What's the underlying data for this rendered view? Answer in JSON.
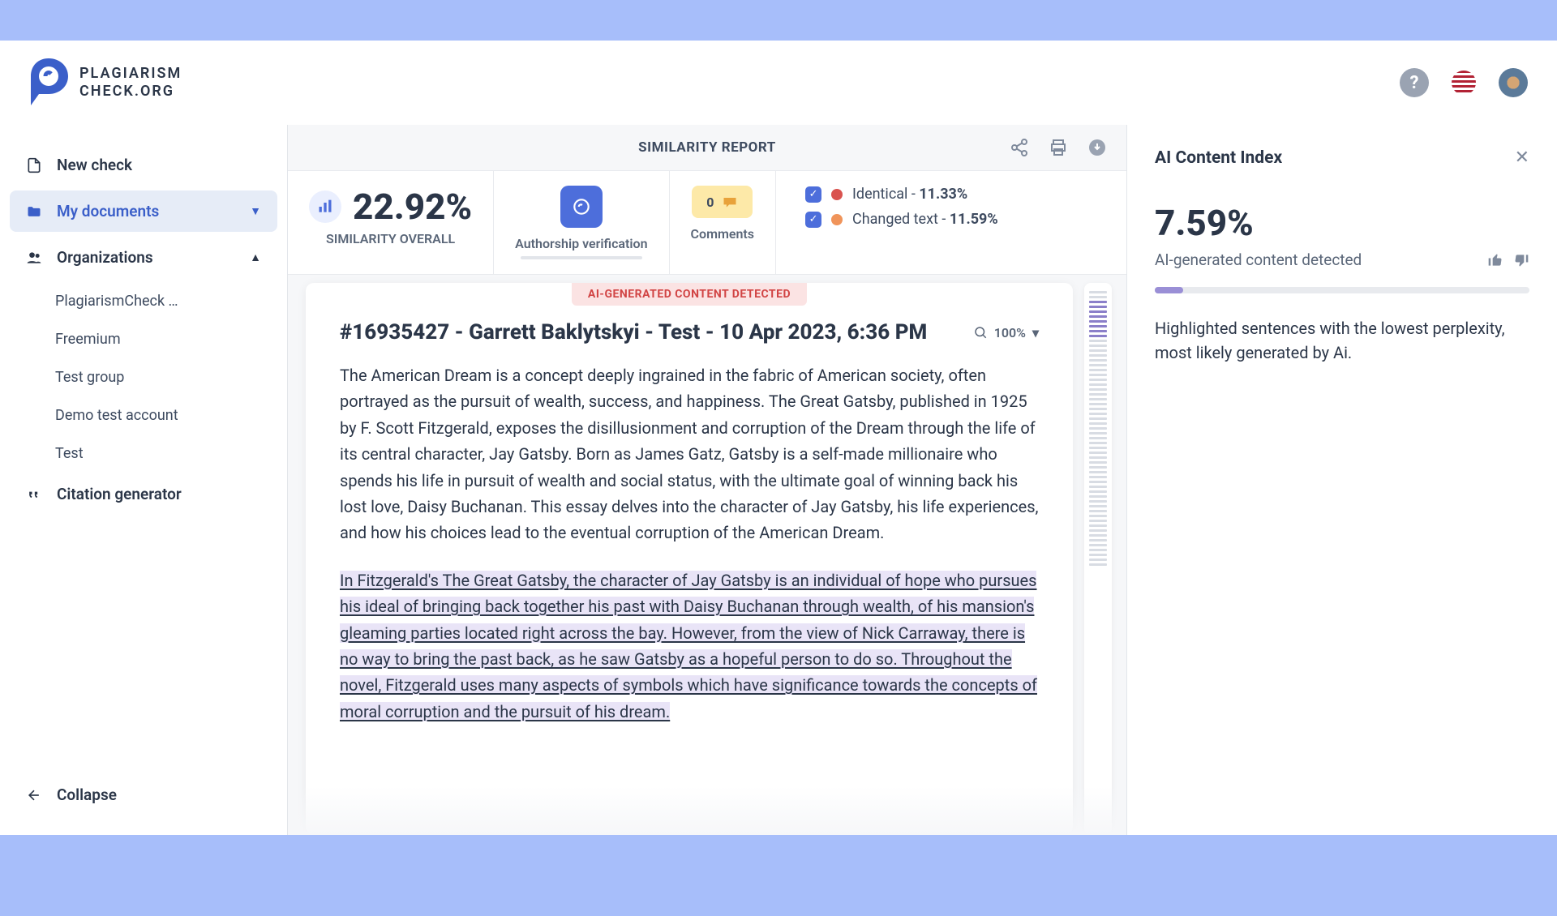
{
  "logo": {
    "line1": "PLAGIARISM",
    "line2": "CHECK.ORG"
  },
  "sidebar": {
    "new_check": "New check",
    "my_documents": "My documents",
    "organizations": "Organizations",
    "org_items": [
      "PlagiarismCheck …",
      "Freemium",
      "Test group",
      "Demo test account",
      "Test"
    ],
    "citation": "Citation generator",
    "collapse": "Collapse"
  },
  "report": {
    "title": "SIMILARITY REPORT",
    "similarity_pct": "22.92%",
    "similarity_label": "SIMILARITY OVERALL",
    "auth_label": "Authorship verification",
    "comments_count": "0",
    "comments_label": "Comments",
    "identical_label": "Identical - ",
    "identical_pct": "11.33%",
    "changed_label": "Changed text - ",
    "changed_pct": "11.59%"
  },
  "doc": {
    "ai_banner": "AI-GENERATED CONTENT DETECTED",
    "title": "#16935427 - Garrett Baklytskyi - Test - 10 Apr 2023, 6:36 PM",
    "zoom": "100%",
    "para1": "The American Dream is a concept deeply ingrained in the fabric of American society, often portrayed as the pursuit of wealth, success, and happiness. The Great Gatsby, published in 1925 by F. Scott Fitzgerald, exposes the disillusionment and corruption of the Dream through the life of its central character, Jay Gatsby. Born as James Gatz, Gatsby is a self-made millionaire who spends his life in pursuit of wealth and social status, with the ultimate goal of winning back his lost love, Daisy Buchanan. This essay delves into the character of Jay Gatsby, his life experiences, and how his choices lead to the eventual corruption of the American Dream.",
    "para2": "In Fitzgerald's The Great Gatsby, the character of Jay Gatsby is an individual of hope who pursues his ideal of bringing back together his past with Daisy Buchanan through wealth, of his mansion's gleaming parties located right across the bay. However, from the view of Nick Carraway, there is no way to bring the past back, as he saw Gatsby as a hopeful person to do so. Throughout the novel, Fitzgerald uses many aspects of symbols which have significance towards the concepts of moral corruption and the pursuit of his dream."
  },
  "ai_panel": {
    "title": "AI Content Index",
    "pct": "7.59%",
    "sub": "AI-generated content detected",
    "desc": "Highlighted sentences with the lowest perplexity, most likely generated by Ai.",
    "fill_pct": "7.59"
  }
}
